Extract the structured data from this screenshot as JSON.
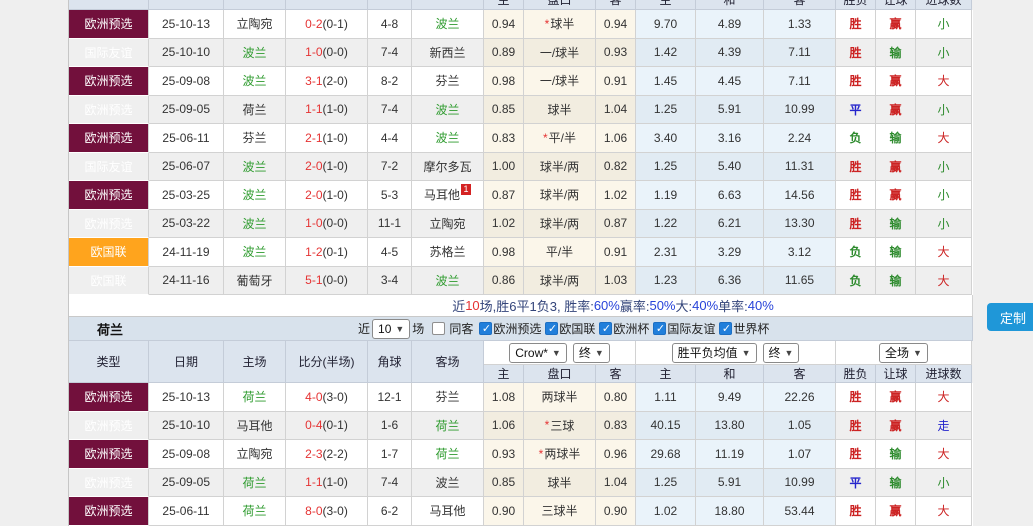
{
  "colors": {
    "badge_euro_qualifier": "#72103c",
    "badge_intl_friendly": "#5b76c3",
    "badge_nations_league": "#ffa41d",
    "team_highlight_green": "#2e9b2e",
    "score_red": "#e53333",
    "result_red": "#cc2222",
    "result_green": "#2e8b2e",
    "result_blue": "#2525cc",
    "header_bg": "#dce4ee",
    "custom_button_blue": "#1f97d8"
  },
  "headers": {
    "left": [
      "类型",
      "日期",
      "主场",
      "比分(半场)",
      "角球",
      "客场"
    ],
    "odds": [
      "主",
      "盘口",
      "客",
      "主",
      "和",
      "客",
      "胜负",
      "让球",
      "进球数"
    ]
  },
  "table1": {
    "green_team": "波兰",
    "rows": [
      {
        "type": "欧洲预选",
        "date": "25-10-13",
        "home": "立陶宛",
        "score_ft": "0-2",
        "score_ht": "(0-1)",
        "corner": "4-8",
        "away": "波兰",
        "ah_home": "0.94",
        "handicap": "*球半",
        "ah_away": "0.94",
        "odds_win": "9.70",
        "odds_draw": "4.89",
        "odds_lose": "1.33",
        "result": "胜",
        "handicap_result": "赢",
        "goals_result": "小"
      },
      {
        "type": "国际友谊",
        "date": "25-10-10",
        "home": "波兰",
        "score_ft": "1-0",
        "score_ht": "(0-0)",
        "corner": "7-4",
        "away": "新西兰",
        "ah_home": "0.89",
        "handicap": "一/球半",
        "ah_away": "0.93",
        "odds_win": "1.42",
        "odds_draw": "4.39",
        "odds_lose": "7.11",
        "result": "胜",
        "handicap_result": "输",
        "goals_result": "小"
      },
      {
        "type": "欧洲预选",
        "date": "25-09-08",
        "home": "波兰",
        "score_ft": "3-1",
        "score_ht": "(2-0)",
        "corner": "8-2",
        "away": "芬兰",
        "ah_home": "0.98",
        "handicap": "一/球半",
        "ah_away": "0.91",
        "odds_win": "1.45",
        "odds_draw": "4.45",
        "odds_lose": "7.11",
        "result": "胜",
        "handicap_result": "赢",
        "goals_result": "大"
      },
      {
        "type": "欧洲预选",
        "date": "25-09-05",
        "home": "荷兰",
        "score_ft": "1-1",
        "score_ht": "(1-0)",
        "corner": "7-4",
        "away": "波兰",
        "ah_home": "0.85",
        "handicap": "球半",
        "ah_away": "1.04",
        "odds_win": "1.25",
        "odds_draw": "5.91",
        "odds_lose": "10.99",
        "result": "平",
        "handicap_result": "赢",
        "goals_result": "小"
      },
      {
        "type": "欧洲预选",
        "date": "25-06-11",
        "home": "芬兰",
        "score_ft": "2-1",
        "score_ht": "(1-0)",
        "corner": "4-4",
        "away": "波兰",
        "ah_home": "0.83",
        "handicap": "*平/半",
        "ah_away": "1.06",
        "odds_win": "3.40",
        "odds_draw": "3.16",
        "odds_lose": "2.24",
        "result": "负",
        "handicap_result": "输",
        "goals_result": "大"
      },
      {
        "type": "国际友谊",
        "date": "25-06-07",
        "home": "波兰",
        "score_ft": "2-0",
        "score_ht": "(1-0)",
        "corner": "7-2",
        "away": "摩尔多瓦",
        "ah_home": "1.00",
        "handicap": "球半/两",
        "ah_away": "0.82",
        "odds_win": "1.25",
        "odds_draw": "5.40",
        "odds_lose": "11.31",
        "result": "胜",
        "handicap_result": "赢",
        "goals_result": "小"
      },
      {
        "type": "欧洲预选",
        "date": "25-03-25",
        "home": "波兰",
        "score_ft": "2-0",
        "score_ht": "(1-0)",
        "corner": "5-3",
        "away": "马耳他",
        "away_card": "1",
        "ah_home": "0.87",
        "handicap": "球半/两",
        "ah_away": "1.02",
        "odds_win": "1.19",
        "odds_draw": "6.63",
        "odds_lose": "14.56",
        "result": "胜",
        "handicap_result": "赢",
        "goals_result": "小"
      },
      {
        "type": "欧洲预选",
        "date": "25-03-22",
        "home": "波兰",
        "score_ft": "1-0",
        "score_ht": "(0-0)",
        "corner": "11-1",
        "away": "立陶宛",
        "ah_home": "1.02",
        "handicap": "球半/两",
        "ah_away": "0.87",
        "odds_win": "1.22",
        "odds_draw": "6.21",
        "odds_lose": "13.30",
        "result": "胜",
        "handicap_result": "输",
        "goals_result": "小"
      },
      {
        "type": "欧国联",
        "date": "24-11-19",
        "home": "波兰",
        "score_ft": "1-2",
        "score_ht": "(0-1)",
        "corner": "4-5",
        "away": "苏格兰",
        "ah_home": "0.98",
        "handicap": "平/半",
        "ah_away": "0.91",
        "odds_win": "2.31",
        "odds_draw": "3.29",
        "odds_lose": "3.12",
        "result": "负",
        "handicap_result": "输",
        "goals_result": "大"
      },
      {
        "type": "欧国联",
        "date": "24-11-16",
        "home": "葡萄牙",
        "score_ft": "5-1",
        "score_ht": "(0-0)",
        "corner": "3-4",
        "away": "波兰",
        "ah_home": "0.86",
        "handicap": "球半/两",
        "ah_away": "1.03",
        "odds_win": "1.23",
        "odds_draw": "6.36",
        "odds_lose": "11.65",
        "result": "负",
        "handicap_result": "输",
        "goals_result": "大"
      }
    ],
    "summary_segments": [
      {
        "text": "近",
        "color": "navy"
      },
      {
        "text": "10",
        "color": "red"
      },
      {
        "text": "场,胜6平1负3, 胜率:",
        "color": "navy"
      },
      {
        "text": "60%",
        "color": "blue"
      },
      {
        "text": " 赢率:",
        "color": "navy"
      },
      {
        "text": "50%",
        "color": "blue"
      },
      {
        "text": " 大:",
        "color": "navy"
      },
      {
        "text": "40%",
        "color": "blue"
      },
      {
        "text": " 单率:",
        "color": "navy"
      },
      {
        "text": "40%",
        "color": "blue"
      }
    ]
  },
  "section2": {
    "title": "荷兰",
    "filter": {
      "near_label": "近",
      "games_count": "10",
      "games_label": "场",
      "same_away_label": "同客",
      "same_away_checked": false,
      "leagues": [
        {
          "label": "欧洲预选",
          "checked": true
        },
        {
          "label": "欧国联",
          "checked": true
        },
        {
          "label": "欧洲杯",
          "checked": true
        },
        {
          "label": "国际友谊",
          "checked": true
        },
        {
          "label": "世界杯",
          "checked": true
        }
      ]
    },
    "dropdowns": {
      "company": "Crow*",
      "final_a": "终",
      "average": "胜平负均值",
      "final_b": "终",
      "scope": "全场"
    }
  },
  "table2": {
    "green_team": "荷兰",
    "rows": [
      {
        "type": "欧洲预选",
        "date": "25-10-13",
        "home": "荷兰",
        "score_ft": "4-0",
        "score_ht": "(3-0)",
        "corner": "12-1",
        "away": "芬兰",
        "ah_home": "1.08",
        "handicap": "两球半",
        "ah_away": "0.80",
        "odds_win": "1.11",
        "odds_draw": "9.49",
        "odds_lose": "22.26",
        "result": "胜",
        "handicap_result": "赢",
        "goals_result": "大"
      },
      {
        "type": "欧洲预选",
        "date": "25-10-10",
        "home": "马耳他",
        "score_ft": "0-4",
        "score_ht": "(0-1)",
        "corner": "1-6",
        "away": "荷兰",
        "ah_home": "1.06",
        "handicap": "*三球",
        "ah_away": "0.83",
        "odds_win": "40.15",
        "odds_draw": "13.80",
        "odds_lose": "1.05",
        "result": "胜",
        "handicap_result": "赢",
        "goals_result": "走"
      },
      {
        "type": "欧洲预选",
        "date": "25-09-08",
        "home": "立陶宛",
        "score_ft": "2-3",
        "score_ht": "(2-2)",
        "corner": "1-7",
        "away": "荷兰",
        "ah_home": "0.93",
        "handicap": "*两球半",
        "ah_away": "0.96",
        "odds_win": "29.68",
        "odds_draw": "11.19",
        "odds_lose": "1.07",
        "result": "胜",
        "handicap_result": "输",
        "goals_result": "大"
      },
      {
        "type": "欧洲预选",
        "date": "25-09-05",
        "home": "荷兰",
        "score_ft": "1-1",
        "score_ht": "(1-0)",
        "corner": "7-4",
        "away": "波兰",
        "ah_home": "0.85",
        "handicap": "球半",
        "ah_away": "1.04",
        "odds_win": "1.25",
        "odds_draw": "5.91",
        "odds_lose": "10.99",
        "result": "平",
        "handicap_result": "输",
        "goals_result": "小"
      },
      {
        "type": "欧洲预选",
        "date": "25-06-11",
        "home": "荷兰",
        "score_ft": "8-0",
        "score_ht": "(3-0)",
        "corner": "6-2",
        "away": "马耳他",
        "ah_home": "0.90",
        "handicap": "三球半",
        "ah_away": "0.90",
        "odds_win": "1.02",
        "odds_draw": "18.80",
        "odds_lose": "53.44",
        "result": "胜",
        "handicap_result": "赢",
        "goals_result": "大"
      }
    ]
  },
  "custom_button_label": "定制"
}
